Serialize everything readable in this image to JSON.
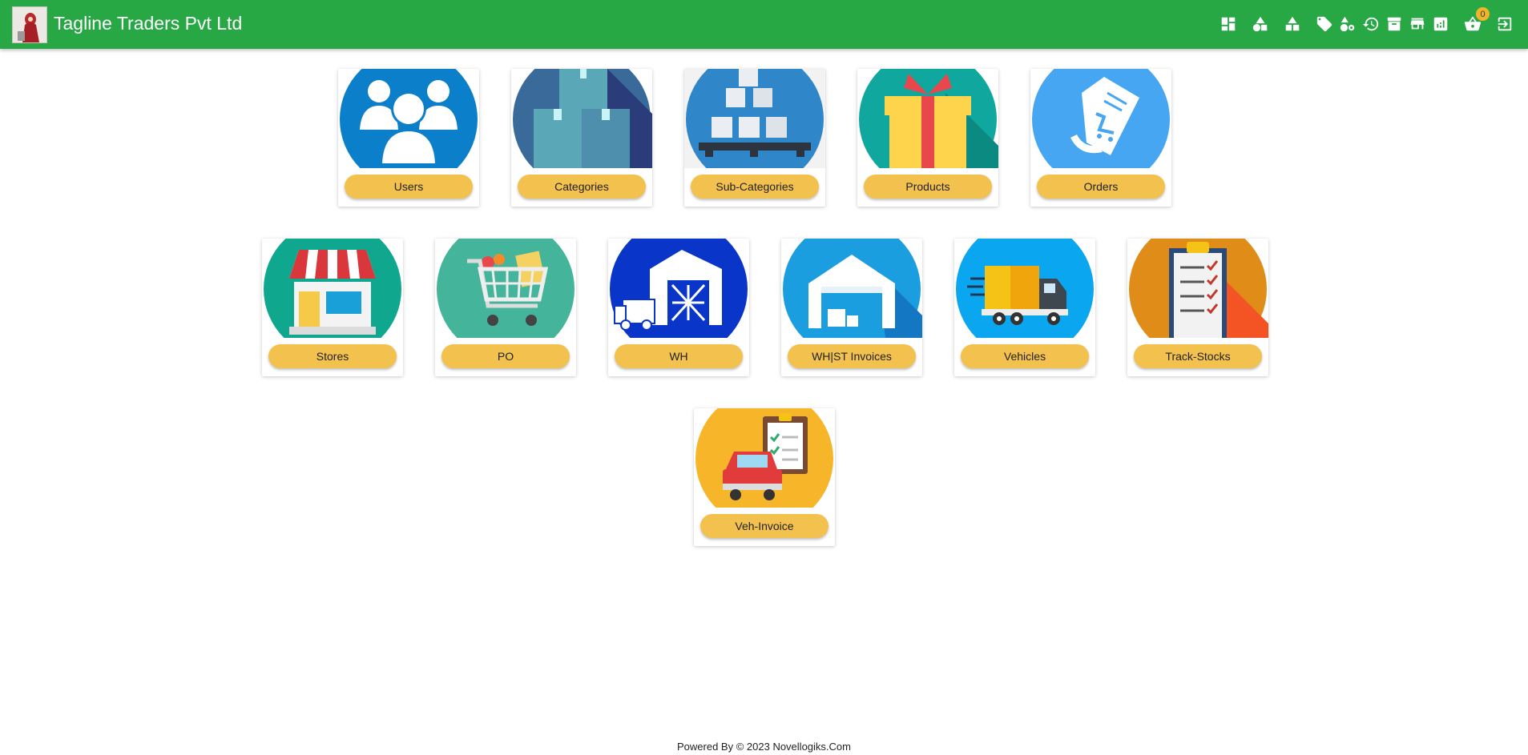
{
  "header": {
    "brand": "Tagline Traders Pvt Ltd",
    "nav_icons": [
      "dashboard-icon",
      "shapes-icon",
      "category-icon",
      "tag-icon",
      "category-settings-icon",
      "history-icon",
      "archive-icon",
      "store-icon",
      "analytics-icon",
      "cart-icon",
      "logout-icon"
    ],
    "cart_count": "0"
  },
  "tiles": [
    {
      "label": "Users"
    },
    {
      "label": "Categories"
    },
    {
      "label": "Sub-Categories"
    },
    {
      "label": "Products"
    },
    {
      "label": "Orders"
    },
    {
      "label": "Stores"
    },
    {
      "label": "PO"
    },
    {
      "label": "WH"
    },
    {
      "label": "WH|ST Invoices"
    },
    {
      "label": "Vehicles"
    },
    {
      "label": "Track-Stocks"
    },
    {
      "label": "Veh-Invoice"
    }
  ],
  "footer": {
    "text": "Powered By © 2023 Novellogiks.Com"
  },
  "colors": {
    "topbar": "#28a745",
    "button": "#f2c14e"
  }
}
